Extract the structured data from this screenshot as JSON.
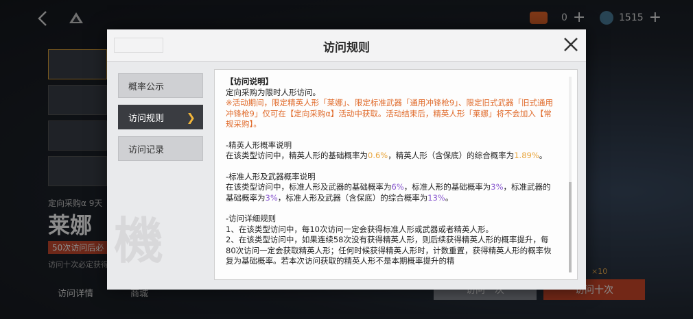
{
  "topbar": {
    "currency1": {
      "value": "0",
      "color": "#e8672a"
    },
    "currency2": {
      "value": "1515",
      "color": "#4a7c9a"
    }
  },
  "background": {
    "sub_label": "定向采购α 9天",
    "name": "莱娜",
    "banner": "50次访问后必",
    "note": "访问十次必定获得",
    "tab1": "访问详情",
    "tab2": "商城",
    "btn_one": "访问一次",
    "btn_ten": "访问十次",
    "x10": "×10"
  },
  "modal": {
    "title": "访问规则",
    "sidebar": [
      {
        "label": "概率公示",
        "active": false
      },
      {
        "label": "访问规则",
        "active": true
      },
      {
        "label": "访问记录",
        "active": false
      }
    ],
    "watermark": "機",
    "content": {
      "heading": "【访问说明】",
      "line1": "定向采购为限时人形访问。",
      "notice": "※活动期间，限定精英人形「莱娜」、限定标准武器「通用冲锋枪9」、限定旧式武器「旧式通用冲锋枪9」仅可在【定向采购α】活动中获取。活动结束后，精英人形「莱娜」将不会加入【常规采购】。",
      "sec1_title": "-精英人形概率说明",
      "sec1_a": "在该类型访问中，精英人形的基础概率为",
      "sec1_p1": "0.6%",
      "sec1_b": "，精英人形（含保底）的综合概率为",
      "sec1_p2": "1.89%",
      "sec1_c": "。",
      "sec2_title": "-标准人形及武器概率说明",
      "sec2_a": "在该类型访问中，标准人形及武器的基础概率为",
      "sec2_p1": "6%",
      "sec2_b": "，标准人形的基础概率为",
      "sec2_p2": "3%",
      "sec2_c": "，标准武器的基础概率为",
      "sec2_p3": "3%",
      "sec2_d": "，标准人形及武器（含保底）的综合概率为",
      "sec2_p4": "13%",
      "sec2_e": "。",
      "sec3_title": "-访问详细规则",
      "sec3_1": "1、在该类型访问中，每10次访问一定会获得标准人形或武器或者精英人形。",
      "sec3_2": "2、在该类型访问中，如果连续58次没有获得精英人形，则后续获得精英人形的概率提升，每80次访问一定会获取精英人形；任何时候获得精英人形时，计数重置，获得精英人形的概率恢复为基础概率。若本次访问获取的精英人形不是本期概率提升的精"
    }
  }
}
